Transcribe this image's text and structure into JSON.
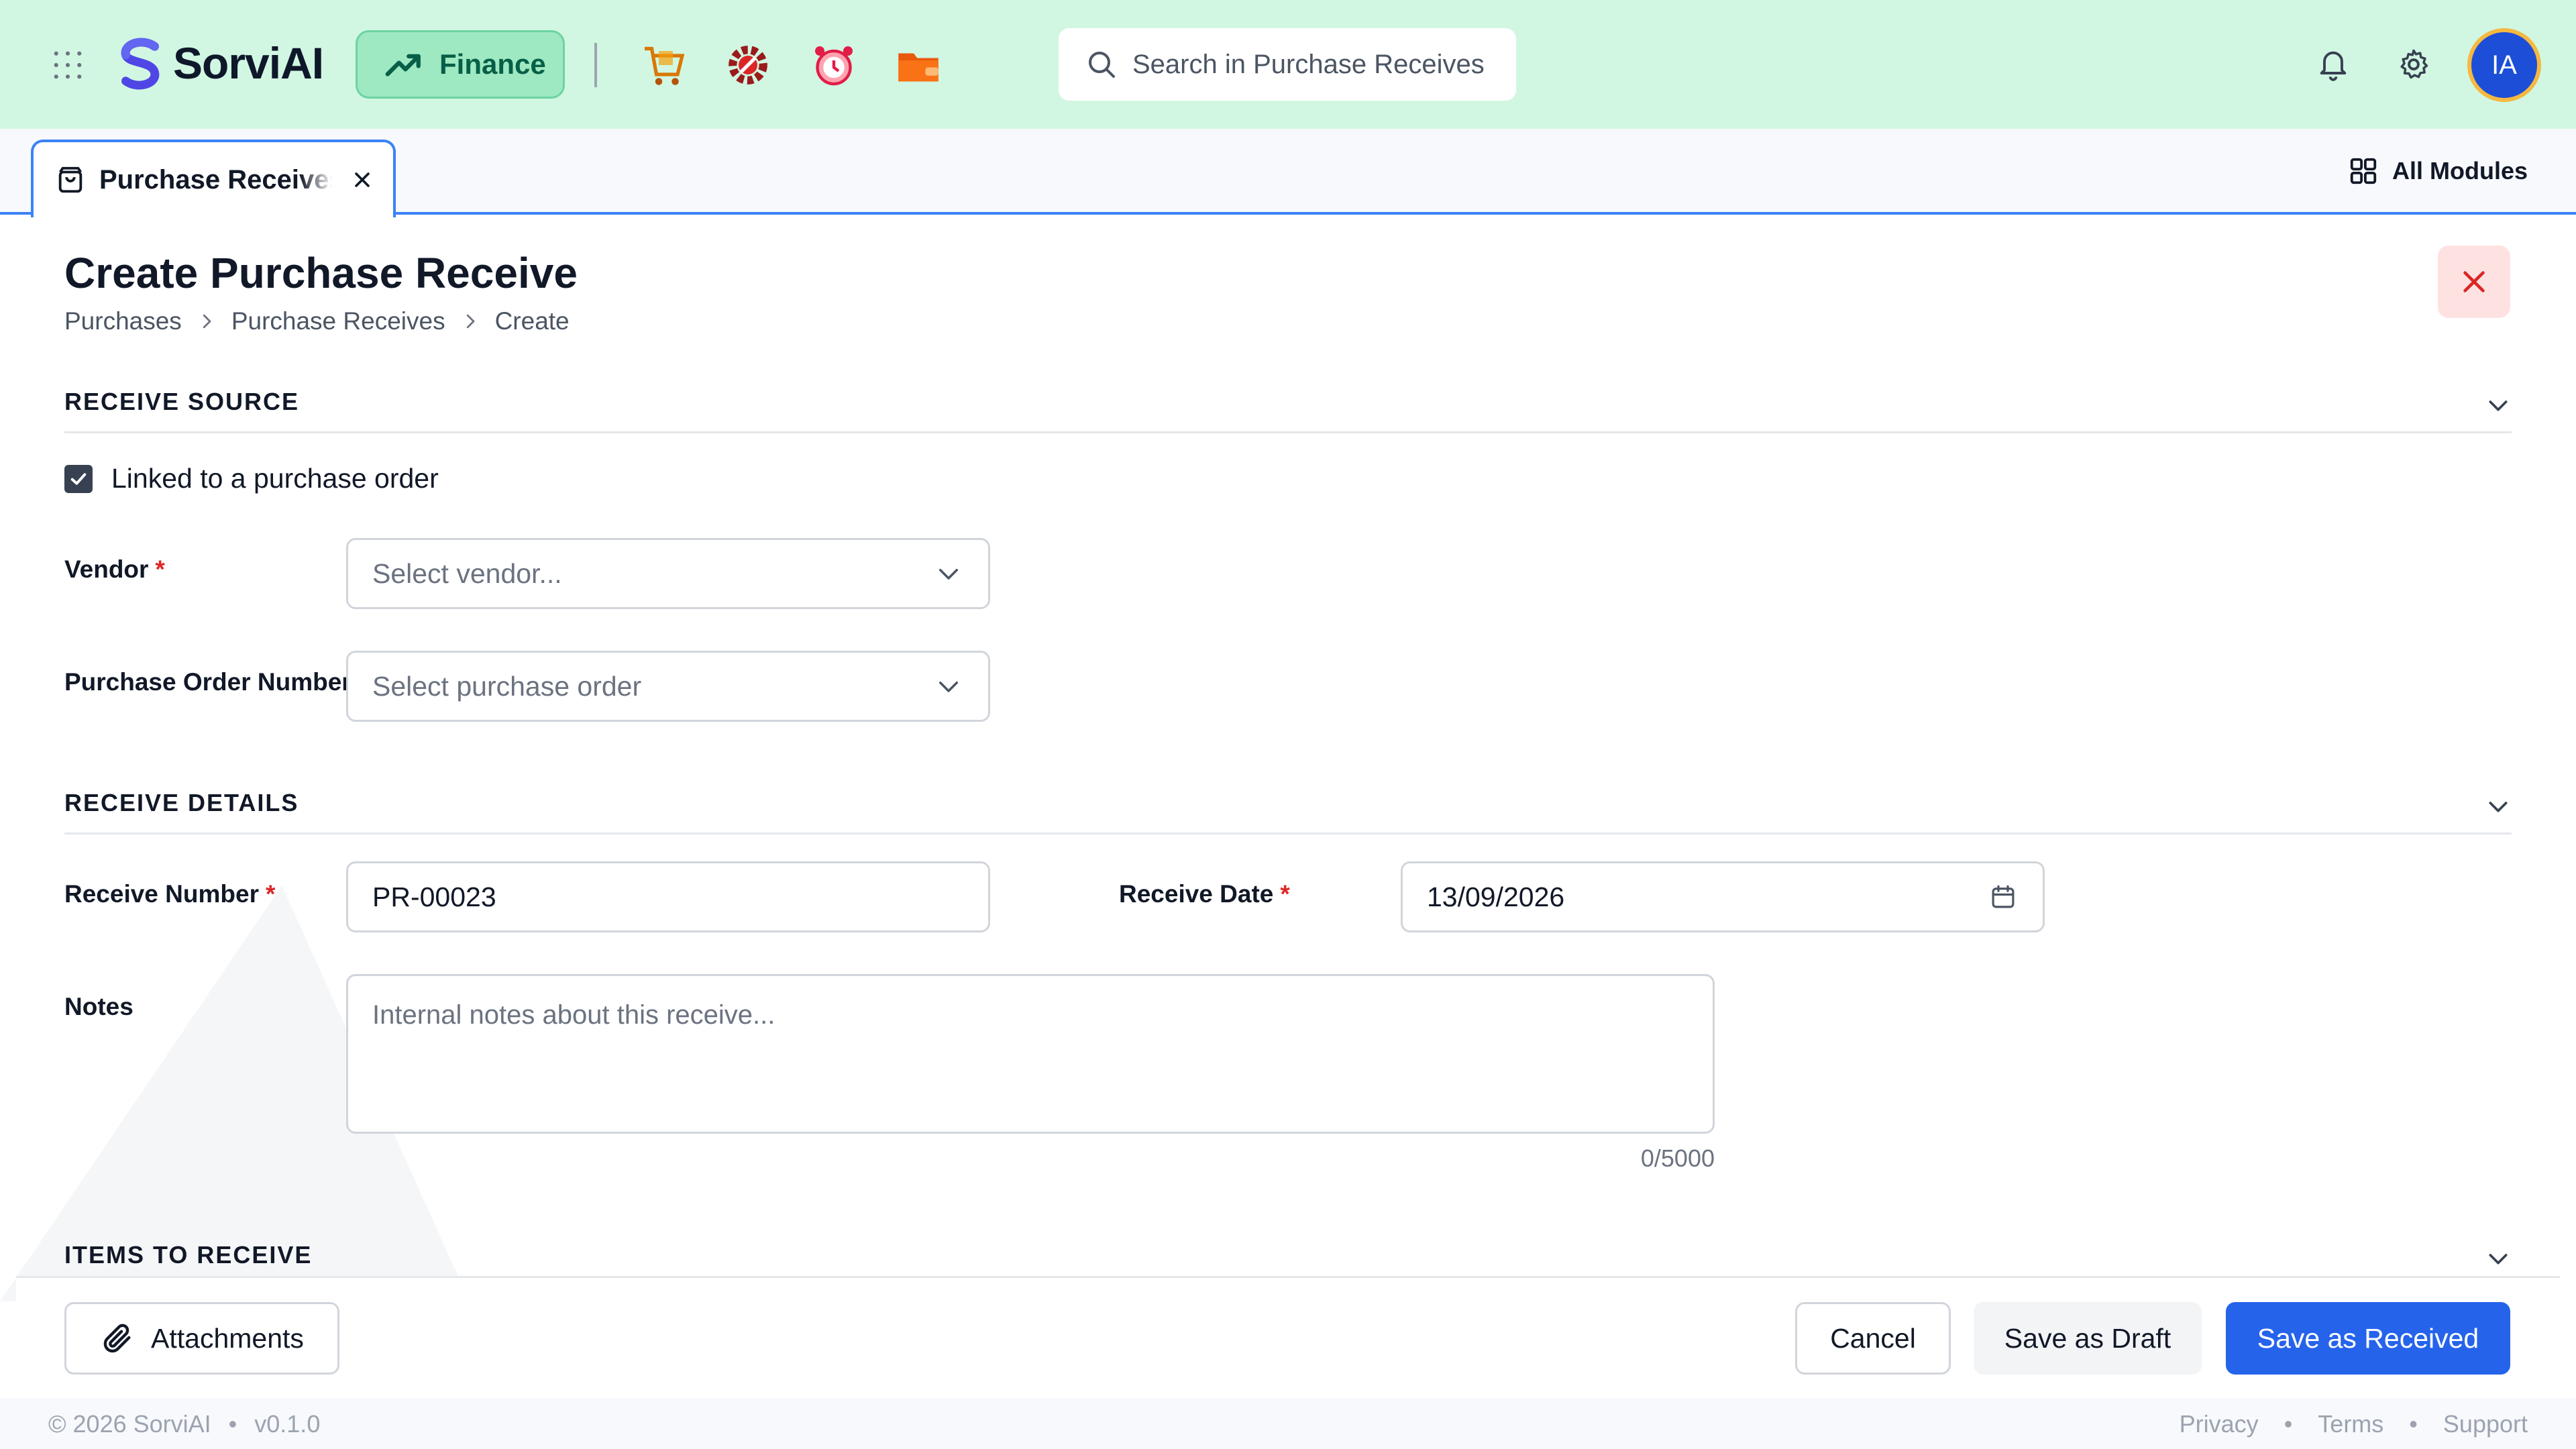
{
  "app": {
    "brand": "SorviAI",
    "module_button": "Finance",
    "search_placeholder": "Search in Purchase Receives",
    "avatar_initials": "IA"
  },
  "tabs": [
    {
      "label": "Purchase Receives"
    }
  ],
  "tabbar": {
    "all_modules": "All Modules"
  },
  "page": {
    "title": "Create Purchase Receive",
    "breadcrumb": [
      "Purchases",
      "Purchase Receives",
      "Create"
    ]
  },
  "sections": {
    "source": {
      "title": "RECEIVE SOURCE",
      "linked_label": "Linked to a purchase order",
      "linked_checked": true,
      "vendor_label": "Vendor",
      "vendor_placeholder": "Select vendor...",
      "po_label": "Purchase Order Number",
      "po_placeholder": "Select purchase order"
    },
    "details": {
      "title": "RECEIVE DETAILS",
      "number_label": "Receive Number",
      "number_value": "PR-00023",
      "date_label": "Receive Date",
      "date_value": "13/09/2026",
      "notes_label": "Notes",
      "notes_placeholder": "Internal notes about this receive...",
      "notes_counter": "0/5000"
    },
    "items": {
      "title": "ITEMS TO RECEIVE"
    }
  },
  "required_mark": "*",
  "actions": {
    "attachments": "Attachments",
    "cancel": "Cancel",
    "save_draft": "Save as Draft",
    "save_received": "Save as Received"
  },
  "footer": {
    "copyright": "© 2026 SorviAI",
    "version": "v0.1.0",
    "separator": "•",
    "links": [
      "Privacy",
      "Terms",
      "Support"
    ]
  },
  "colors": {
    "topbar_bg": "#d1f7e2",
    "finance_bg": "#9ee8c2",
    "accent_blue": "#2563eb",
    "required_red": "#dc2626",
    "close_bg": "#fee2e2"
  },
  "icons": {
    "grid": "apps-grid-icon",
    "finance": "trending-up-icon",
    "tab": "shopping-bag-icon",
    "search": "search-icon",
    "notifications": "bell-icon",
    "settings": "gear-icon",
    "calendar": "calendar-icon",
    "attachments": "paperclip-icon"
  }
}
